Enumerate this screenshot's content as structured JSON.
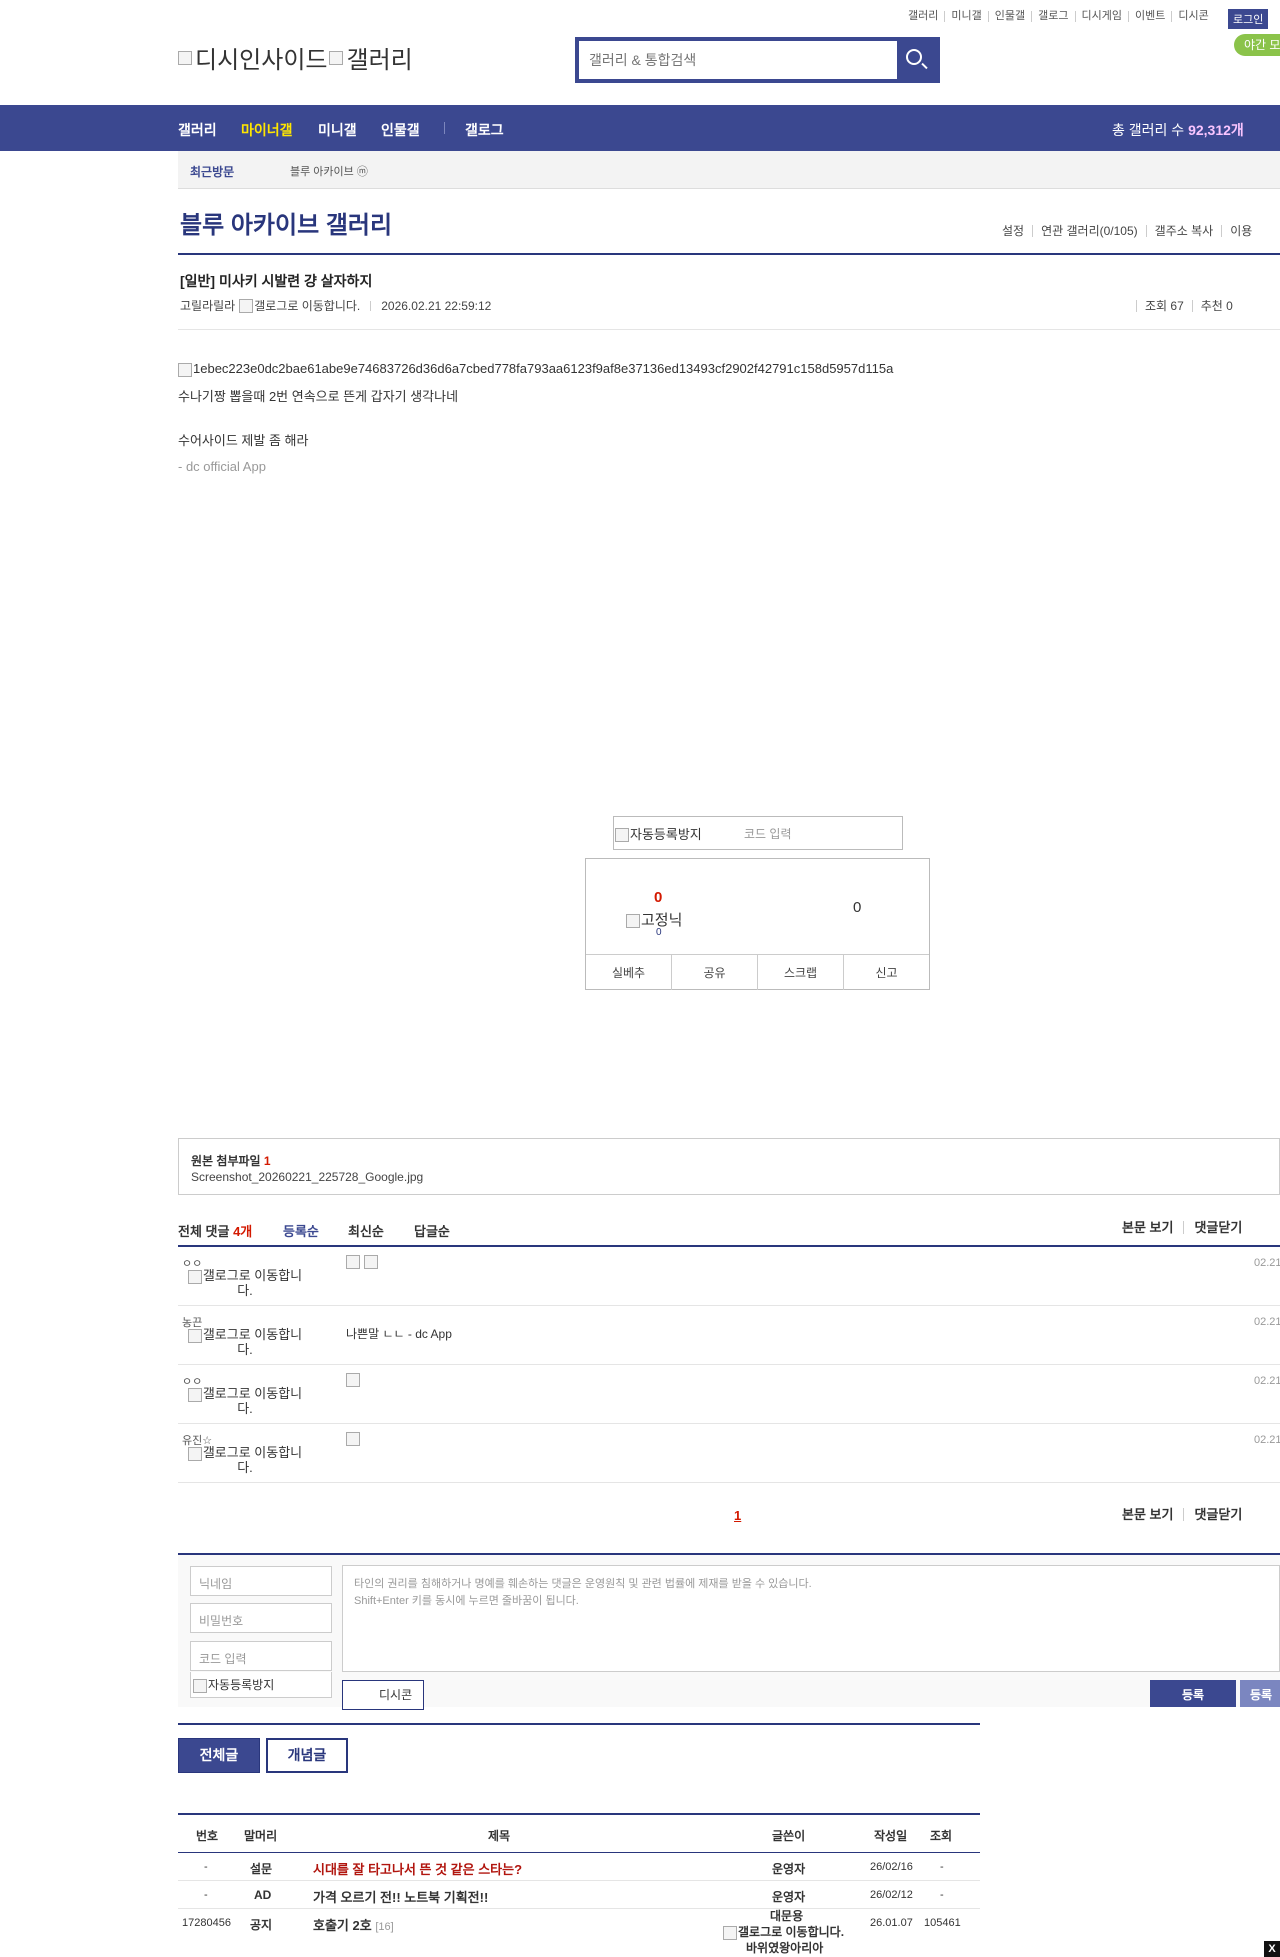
{
  "top_links": [
    "갤러리",
    "미니갤",
    "인물갤",
    "갤로그",
    "디시게임",
    "이벤트",
    "디시콘"
  ],
  "login_label": "로그인",
  "night_mode_label": "야간 모",
  "logo": {
    "alt1": "디시인사이드",
    "alt2": "갤러리"
  },
  "search": {
    "placeholder": "갤러리 & 통합검색"
  },
  "gnb": {
    "items": [
      "갤러리",
      "마이너갤",
      "미니갤",
      "인물갤",
      "갤로그"
    ],
    "total_prefix": "총 갤러리 수 ",
    "total_value": "92,312개"
  },
  "recent": {
    "label": "최근방문",
    "item": "블루 아카이브",
    "item_icon": "ⓜ"
  },
  "gallery": {
    "title": "블루 아카이브 갤러리",
    "menu": [
      "설정",
      "연관 갤러리(0/105)",
      "갤주소 복사",
      "이용"
    ]
  },
  "post": {
    "title": "[일반] 미사키 시발련 걍 살자하지",
    "author": "고릴라릴라",
    "gallog_alt": "갤로그로 이동합니다.",
    "datetime": "2026.02.21 22:59:12",
    "views_label": "조회 67",
    "recommend_label": "추천 0",
    "image_alt": "1ebec223e0dc2bae61abe9e74683726d36d6a7cbed778fa793aa6123f9af8e37136ed13493cf2902f42791c158d5957d115a",
    "line1": "수나기짱 뽑을때 2번 연속으로 뜬게 갑자기 생각나네",
    "line2": "수어사이드 제발 좀 해라",
    "app_sig": "- dc official App"
  },
  "captcha": {
    "img_alt": "자동등록방지",
    "input_placeholder": "코드 입력"
  },
  "recommend": {
    "up": "0",
    "fixed_alt": "고정닉",
    "fixed_count": "0",
    "down": "0",
    "actions": [
      "실베추",
      "공유",
      "스크랩",
      "신고"
    ]
  },
  "attachment": {
    "title": "원본 첨부파일 ",
    "count": "1",
    "file": "Screenshot_20260221_225728_Google.jpg"
  },
  "comments": {
    "head_label": "전체 댓글 ",
    "count": "4개",
    "sorts": [
      "등록순",
      "최신순",
      "답글순"
    ],
    "right_actions": [
      "본문 보기",
      "댓글닫기"
    ],
    "items": [
      {
        "nick": "ㅇㅇ",
        "gallog": "갤로그로 이동합니다.",
        "text": "",
        "date": "02.21"
      },
      {
        "nick": "농끈",
        "gallog": "갤로그로 이동합니다.",
        "text": "나쁜말 ㄴㄴ - dc App",
        "date": "02.21"
      },
      {
        "nick": "ㅇㅇ",
        "gallog": "갤로그로 이동합니다.",
        "text": "",
        "date": "02.21"
      },
      {
        "nick": "유진☆",
        "gallog": "갤로그로 이동합니다.",
        "text": "",
        "date": "02.21"
      }
    ],
    "page": "1"
  },
  "write": {
    "nick_placeholder": "닉네임",
    "pw_placeholder": "비밀번호",
    "code_placeholder": "코드 입력",
    "captcha_alt": "자동등록방지",
    "text_line1": "타인의 권리를 침해하거나 명예를 훼손하는 댓글은 운영원칙 및 관련 법률에 제재를 받을 수 있습니다.",
    "text_line2": "Shift+Enter 키를 동시에 누르면 줄바꿈이 됩니다.",
    "dccon_label": "디시콘",
    "submit_label": "등록",
    "submit2_label": "등록"
  },
  "list": {
    "tabs": [
      "전체글",
      "개념글"
    ],
    "headers": [
      "번호",
      "말머리",
      "제목",
      "글쓴이",
      "작성일",
      "조회"
    ],
    "rows": [
      {
        "num": "-",
        "head": "설문",
        "title": "시대를 잘 타고나서 뜬 것 같은 스타는?",
        "writer": "운영자",
        "date": "26/02/16",
        "views": "-",
        "red": true,
        "reply": ""
      },
      {
        "num": "-",
        "head": "AD",
        "title": "가격 오르기 전!! 노트북 기획전!!",
        "writer": "운영자",
        "date": "26/02/12",
        "views": "-",
        "red": false,
        "reply": ""
      },
      {
        "num": "17280456",
        "head": "공지",
        "title": "호출기 2호",
        "writer": "대문용",
        "writer_alt": "갤로그로 이동합니다.",
        "writer_extra": "바위였왕아리아",
        "date": "26.01.07",
        "views": "105461",
        "red": false,
        "reply": "[16]"
      }
    ]
  },
  "close_label": "X"
}
